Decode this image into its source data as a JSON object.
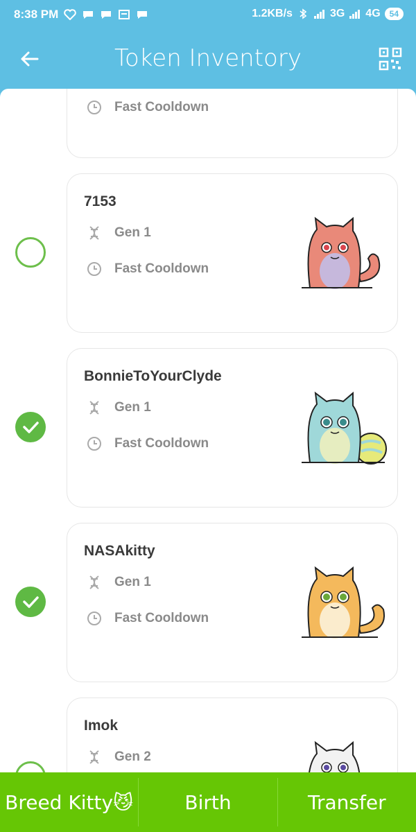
{
  "status_bar": {
    "time": "8:38 PM",
    "network_speed": "1.2KB/s",
    "network_3g": "3G",
    "network_4g": "4G",
    "battery": "54"
  },
  "header": {
    "title": "Token Inventory",
    "back_icon": "arrow-left-icon",
    "qr_icon": "qr-code-icon"
  },
  "kitties": [
    {
      "name": "",
      "gen": "",
      "cooldown": "Fast Cooldown",
      "selected": false,
      "colors": {
        "body": "#f4b95c",
        "belly": "#fbe6c4"
      }
    },
    {
      "name": "7153",
      "gen": "Gen 1",
      "cooldown": "Fast Cooldown",
      "selected": false,
      "colors": {
        "body": "#e98979",
        "belly": "#c6b8dc"
      }
    },
    {
      "name": "BonnieToYourClyde",
      "gen": "Gen 1",
      "cooldown": "Fast Cooldown",
      "selected": true,
      "colors": {
        "body": "#9fd8d9",
        "belly": "#e6edc0"
      }
    },
    {
      "name": "NASAkitty",
      "gen": "Gen 1",
      "cooldown": "Fast Cooldown",
      "selected": true,
      "colors": {
        "body": "#f4b95c",
        "belly": "#fbeccd"
      }
    },
    {
      "name": "Imok",
      "gen": "Gen 2",
      "cooldown": "",
      "selected": false,
      "colors": {
        "body": "#f2f2f2",
        "belly": "#ffffff"
      }
    }
  ],
  "bottom_bar": {
    "breed_label": "Breed Kitty😼",
    "birth_label": "Birth",
    "transfer_label": "Transfer"
  },
  "colors": {
    "header_bg": "#5ebfe3",
    "accent_green": "#5fb944",
    "bottom_bar_bg": "#66c605"
  }
}
